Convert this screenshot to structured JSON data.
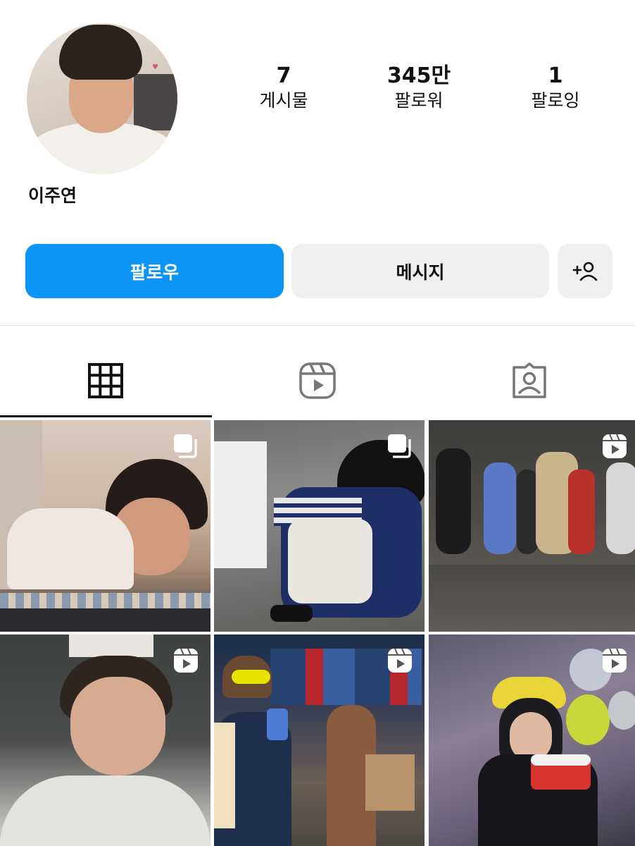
{
  "profile": {
    "username": "이주연",
    "avatar_icon": "profile-photo"
  },
  "stats": {
    "posts": {
      "count": "7",
      "label": "게시물"
    },
    "followers": {
      "count": "345만",
      "label": "팔로워"
    },
    "following": {
      "count": "1",
      "label": "팔로잉"
    }
  },
  "actions": {
    "follow_label": "팔로우",
    "message_label": "메시지",
    "add_icon": "add-person-icon"
  },
  "tabs": [
    {
      "name": "posts",
      "icon": "grid-icon",
      "active": true
    },
    {
      "name": "reels",
      "icon": "reels-icon",
      "active": false
    },
    {
      "name": "tagged",
      "icon": "tagged-person-icon",
      "active": false
    }
  ],
  "posts": [
    {
      "type": "carousel",
      "icon": "carousel-icon"
    },
    {
      "type": "carousel",
      "icon": "carousel-icon"
    },
    {
      "type": "reel",
      "icon": "reel-icon"
    },
    {
      "type": "reel",
      "icon": "reel-icon"
    },
    {
      "type": "reel",
      "icon": "reel-icon"
    },
    {
      "type": "reel",
      "icon": "reel-icon"
    }
  ],
  "colors": {
    "follow_button": "#0c95f6",
    "secondary_button": "#efefef",
    "text": "#111111"
  }
}
